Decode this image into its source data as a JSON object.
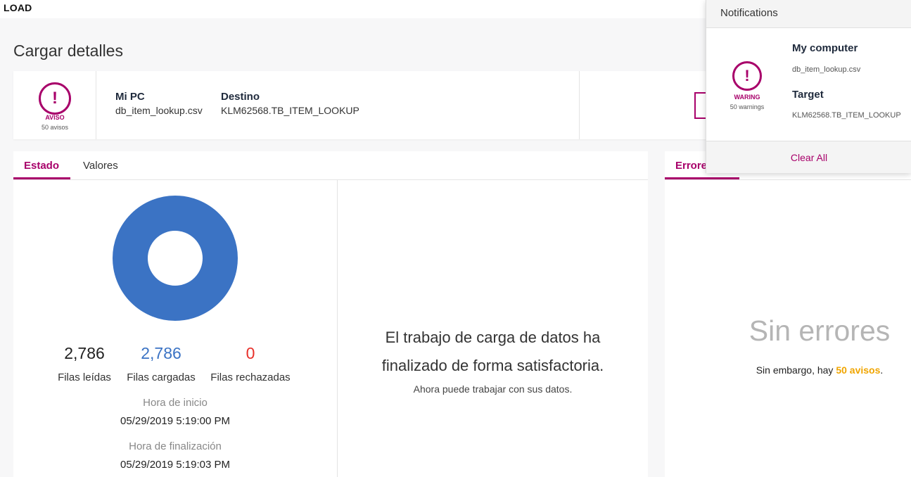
{
  "app": {
    "brand": "LOAD"
  },
  "page": {
    "title": "Cargar detalles"
  },
  "details": {
    "warning": {
      "icon": "exclamation-icon",
      "symbol": "!",
      "label": "AVISO",
      "count_text": "50 avisos"
    },
    "source": {
      "label": "Mi PC",
      "value": "db_item_lookup.csv"
    },
    "target": {
      "label": "Destino",
      "value": "KLM62568.TB_ITEM_LOOKUP"
    }
  },
  "status_tabs": [
    {
      "label": "Estado",
      "active": true
    },
    {
      "label": "Valores",
      "active": false
    }
  ],
  "status": {
    "donut": {
      "loaded_fraction": 1.0,
      "color": "#3b73c4"
    },
    "stats": [
      {
        "value": "2,786",
        "label": "Filas leídas",
        "color": "#222222"
      },
      {
        "value": "2,786",
        "label": "Filas cargadas",
        "color": "#3b73c4"
      },
      {
        "value": "0",
        "label": "Filas rechazadas",
        "color": "#e8302a"
      }
    ],
    "start_label": "Hora de inicio",
    "start_value": "05/29/2019 5:19:00 PM",
    "end_label": "Hora de finalización",
    "end_value": "05/29/2019 5:19:03 PM",
    "message_line1": "El trabajo de carga de datos ha",
    "message_line2": "finalizado de forma satisfactoria.",
    "message_sub": "Ahora puede trabajar con sus datos."
  },
  "errors": {
    "tab_label": "Errores",
    "title": "Sin errores",
    "sub_prefix": "Sin embargo, hay ",
    "sub_highlight": "50 avisos",
    "sub_suffix": "."
  },
  "notifications": {
    "title": "Notifications",
    "warning": {
      "icon": "exclamation-icon",
      "symbol": "!",
      "label": "WARING",
      "count_text": "50 warnings"
    },
    "source_label": "My computer",
    "source_value": "db_item_lookup.csv",
    "target_label": "Target",
    "target_value": "KLM62568.TB_ITEM_LOOKUP",
    "clear_all": "Clear All"
  },
  "colors": {
    "accent": "#a8006a",
    "blue": "#3b73c4",
    "red": "#e8302a",
    "orange": "#f0a500"
  }
}
